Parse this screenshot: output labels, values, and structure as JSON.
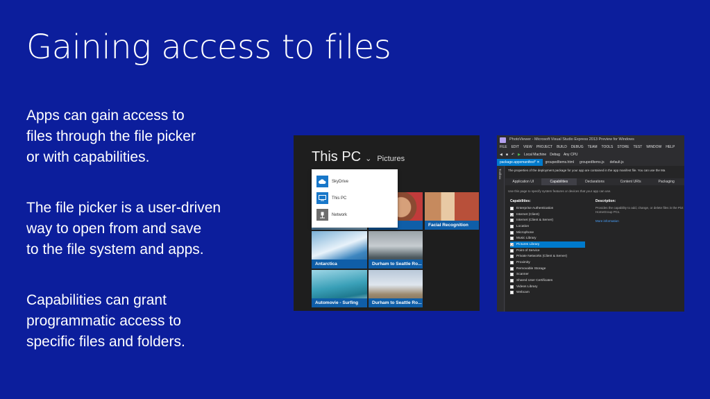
{
  "slide": {
    "title": "Gaining access to files",
    "paragraphs": [
      [
        "Apps can gain access to",
        "files through the file picker",
        "or with capabilities."
      ],
      [
        "The file picker is a user-driven",
        "way to open from and save",
        "to the file system and apps."
      ],
      [
        "Capabilities can grant",
        "programmatic access to",
        "specific files and folders."
      ]
    ],
    "background_color": "#0c1e9c"
  },
  "file_picker": {
    "location_title": "This PC",
    "breadcrumb": "Pictures",
    "locations": [
      {
        "label": "SkyDrive",
        "icon": "cloud-icon"
      },
      {
        "label": "This PC",
        "icon": "computer-icon"
      },
      {
        "label": "Network",
        "icon": "network-icon"
      }
    ],
    "tiles": [
      {
        "caption": "Facial Recognition"
      },
      {
        "caption": "Antarctica"
      },
      {
        "caption": "Durham to Seattle Ro..."
      },
      {
        "caption": "Automovie - Surfing"
      },
      {
        "caption": "Durham to Seattle Ro..."
      }
    ],
    "accent_color": "#0f5ea8"
  },
  "visual_studio": {
    "window_title": "PhotoViewer - Microsoft Visual Studio Express 2013 Preview for Windows",
    "menus": [
      "FILE",
      "EDIT",
      "VIEW",
      "PROJECT",
      "BUILD",
      "DEBUG",
      "TEAM",
      "TOOLS",
      "STORE",
      "TEST",
      "WINDOW",
      "HELP"
    ],
    "toolbar": {
      "run_target": "Local Machine",
      "configuration": "Debug",
      "platform": "Any CPU"
    },
    "doc_tabs": [
      "package.appxmanifest*",
      "groupedItems.html",
      "groupedItems.js",
      "default.js"
    ],
    "toolbox_label": "Toolbox",
    "manifest_description": "The properties of the deployment package for your app are contained in the app manifest file. You can use the Ma",
    "content_tabs": [
      "Application UI",
      "Capabilities",
      "Declarations",
      "Content URIs",
      "Packaging"
    ],
    "active_content_tab": "Capabilities",
    "hint": "Use this page to specify system features or devices that your app can use.",
    "capabilities_header": "Capabilities:",
    "capabilities": [
      {
        "label": "Enterprise Authentication",
        "checked": false,
        "selected": false
      },
      {
        "label": "Internet (Client)",
        "checked": true,
        "selected": false
      },
      {
        "label": "Internet (Client & Server)",
        "checked": false,
        "selected": false
      },
      {
        "label": "Location",
        "checked": false,
        "selected": false
      },
      {
        "label": "Microphone",
        "checked": false,
        "selected": false
      },
      {
        "label": "Music Library",
        "checked": false,
        "selected": false
      },
      {
        "label": "Pictures Library",
        "checked": true,
        "selected": true
      },
      {
        "label": "Point of Service",
        "checked": false,
        "selected": false
      },
      {
        "label": "Private Networks (Client & Server)",
        "checked": false,
        "selected": false
      },
      {
        "label": "Proximity",
        "checked": false,
        "selected": false
      },
      {
        "label": "Removable Storage",
        "checked": false,
        "selected": false
      },
      {
        "label": "Scanner",
        "checked": false,
        "selected": false
      },
      {
        "label": "Shared User Certificates",
        "checked": false,
        "selected": false
      },
      {
        "label": "Videos Library",
        "checked": false,
        "selected": false
      },
      {
        "label": "Webcam",
        "checked": false,
        "selected": false
      }
    ],
    "description_header": "Description:",
    "description_text": "Provides the capability to add, change, or delete files in the Pict HomeGroup PCs.",
    "more_info_link": "More information",
    "accent_color": "#007acc"
  }
}
